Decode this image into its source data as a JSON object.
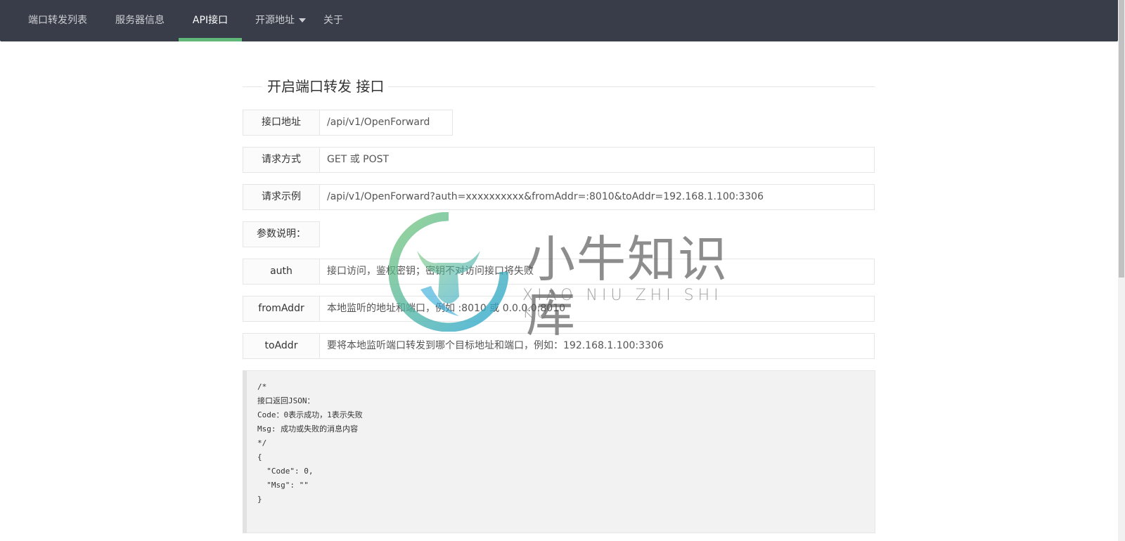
{
  "nav": {
    "items": [
      {
        "label": "端口转发列表"
      },
      {
        "label": "服务器信息"
      },
      {
        "label": "API接口"
      },
      {
        "label": "开源地址"
      },
      {
        "label": "关于"
      }
    ],
    "active_index": 2,
    "active_indicator_color": "#5fb878",
    "background_color": "#393d49"
  },
  "section": {
    "title": "开启端口转发 接口"
  },
  "fields": {
    "api_url": {
      "label": "接口地址",
      "value": "/api/v1/OpenForward"
    },
    "method": {
      "label": "请求方式",
      "value": "GET 或 POST"
    },
    "example": {
      "label": "请求示例",
      "value": "/api/v1/OpenForward?auth=xxxxxxxxxx&fromAddr=:8010&toAddr=192.168.1.100:3306"
    },
    "params": {
      "label": "参数说明："
    },
    "auth": {
      "label": "auth",
      "value": "接口访问，鉴权密钥；密钥不对访问接口将失败"
    },
    "fromAddr": {
      "label": "fromAddr",
      "value": "本地监听的地址和端口，例如 :8010 或 0.0.0.0:8010"
    },
    "toAddr": {
      "label": "toAddr",
      "value": "要将本地监听端口转发到哪个目标地址和端口，例如：192.168.1.100:3306"
    }
  },
  "code_block": {
    "text": "/*\n接口返回JSON：\nCode：0表示成功，1表示失败\nMsg: 成功或失败的消息内容\n*/\n{\n  \"Code\": 0,\n  \"Msg\": \"\"\n}"
  },
  "watermark": {
    "cn": "小牛知识库",
    "en": "XIAO NIU ZHI SHI KU"
  }
}
